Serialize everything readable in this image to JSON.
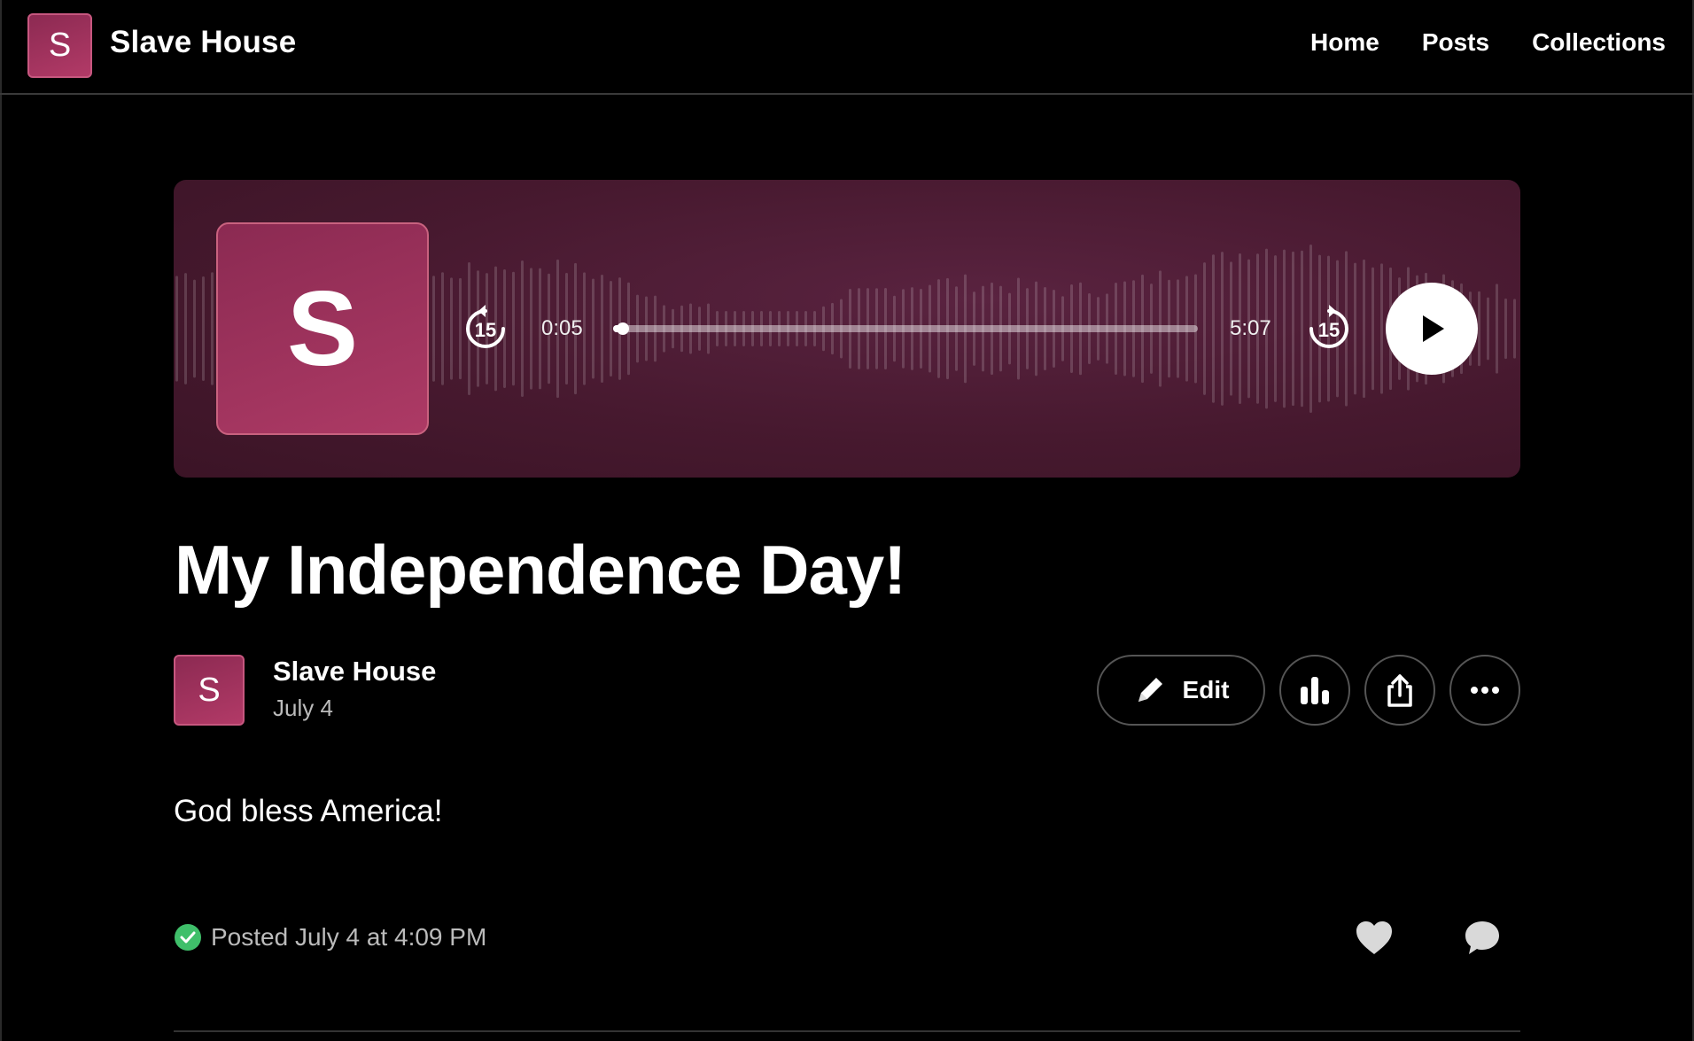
{
  "header": {
    "logo_letter": "S",
    "site_title": "Slave House",
    "nav": [
      {
        "label": "Home"
      },
      {
        "label": "Posts"
      },
      {
        "label": "Collections"
      }
    ]
  },
  "player": {
    "cover_letter": "S",
    "current_time": "0:05",
    "total_time": "5:07",
    "progress": 0.016,
    "skip_back_label": "15",
    "skip_forward_label": "15",
    "accent_color": "#8c2a52"
  },
  "post": {
    "title": "My Independence Day!",
    "author_letter": "S",
    "author_name": "Slave House",
    "date": "July 4",
    "edit_label": "Edit",
    "body": "God bless America!",
    "posted_status": "Posted July 4 at 4:09 PM",
    "status_color": "#3fbf6a"
  },
  "icons": {
    "actions": [
      "pencil-icon",
      "stats-icon",
      "share-icon",
      "more-icon"
    ],
    "reactions": [
      "heart-icon",
      "comment-icon"
    ]
  }
}
